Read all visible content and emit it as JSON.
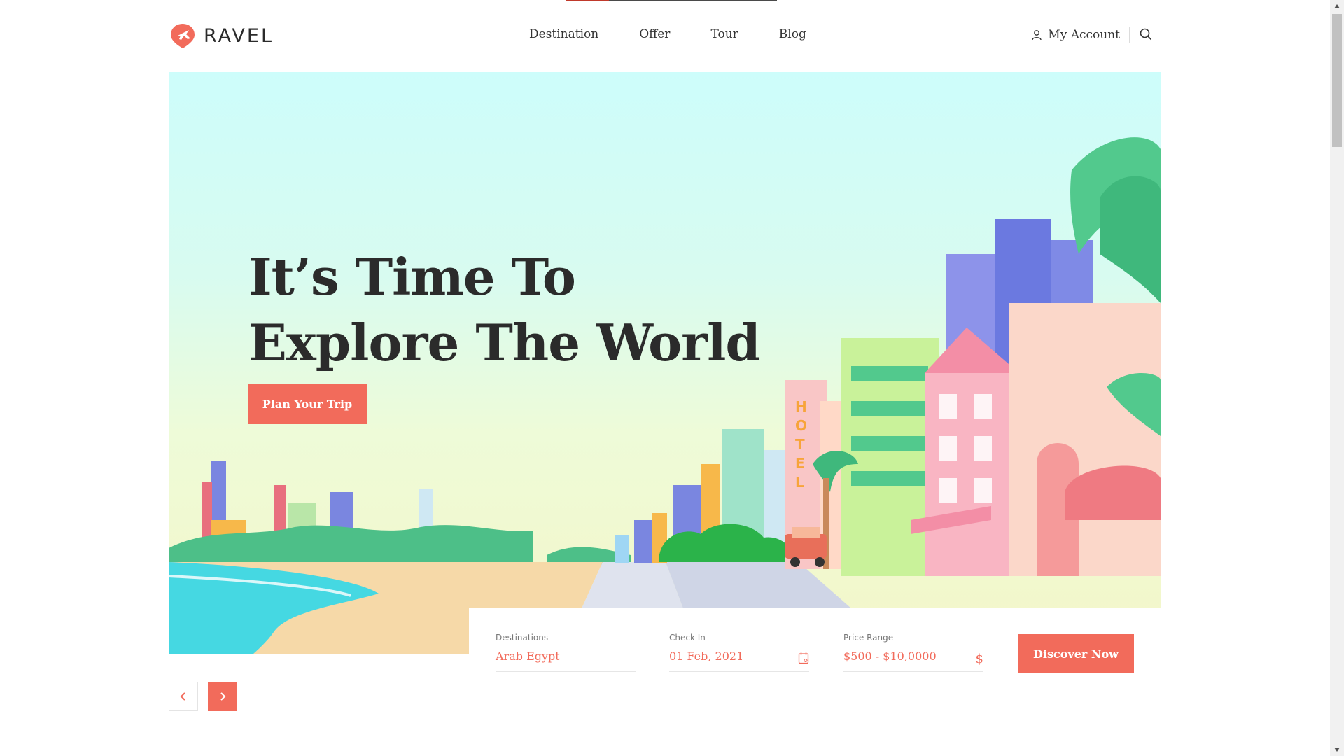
{
  "brand": {
    "name": "RAVEL",
    "accent_color": "#f26b5b"
  },
  "nav": {
    "items": [
      {
        "label": "Destination"
      },
      {
        "label": "Offer"
      },
      {
        "label": "Tour"
      },
      {
        "label": "Blog"
      }
    ],
    "account_label": "My Account",
    "account_icon": "user-icon",
    "search_icon": "search-icon"
  },
  "hero": {
    "title_line1": "It’s Time To",
    "title_line2": "Explore The World",
    "cta_label": "Plan Your Trip",
    "hotel_sign": "HOTEL"
  },
  "search_panel": {
    "destination": {
      "label": "Destinations",
      "value": "Arab Egypt"
    },
    "check_in": {
      "label": "Check In",
      "value": "01 Feb, 2021",
      "icon": "calendar-icon"
    },
    "price_range": {
      "label": "Price Range",
      "value": "$500 - $10,0000",
      "icon_glyph": "$"
    },
    "submit_label": "Discover Now"
  },
  "slider": {
    "prev_icon": "chevron-left-icon",
    "next_icon": "chevron-right-icon"
  }
}
